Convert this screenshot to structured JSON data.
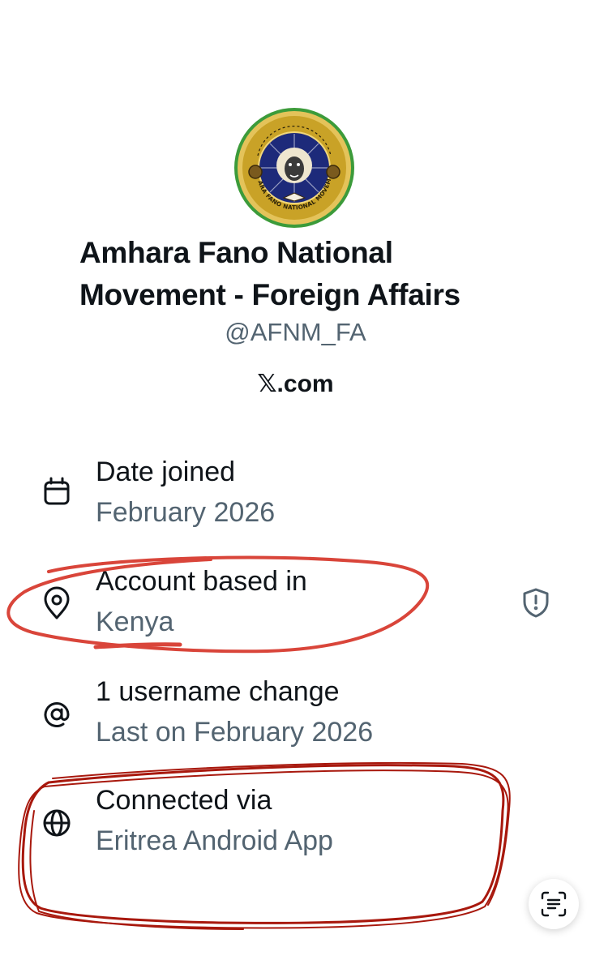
{
  "profile": {
    "display_name": "Amhara Fano National Movement - Foreign Affairs",
    "handle": "@AFNM_FA",
    "source": "𝕏.com",
    "logo_text": "AMHARA FANO NATIONAL MOVEMENT"
  },
  "info_rows": [
    {
      "icon": "calendar-icon",
      "title": "Date joined",
      "value": "February 2026"
    },
    {
      "icon": "location-pin-icon",
      "title": "Account based in",
      "value": "Kenya"
    },
    {
      "icon": "at-sign-icon",
      "title": "1 username change",
      "value": "Last on February 2026"
    },
    {
      "icon": "globe-icon",
      "title": "Connected via",
      "value": "Eritrea Android App"
    }
  ],
  "icons": {
    "shield": "shield-alert-icon",
    "scan": "scan-text-icon"
  },
  "colors": {
    "primary_text": "#0f1419",
    "secondary_text": "#536471",
    "annotation_red": "#d9453a",
    "annotation_dark_red": "#a8180d",
    "logo_gold": "#c9a227",
    "logo_blue": "#1d2a7a",
    "logo_green": "#3c9b3a"
  }
}
